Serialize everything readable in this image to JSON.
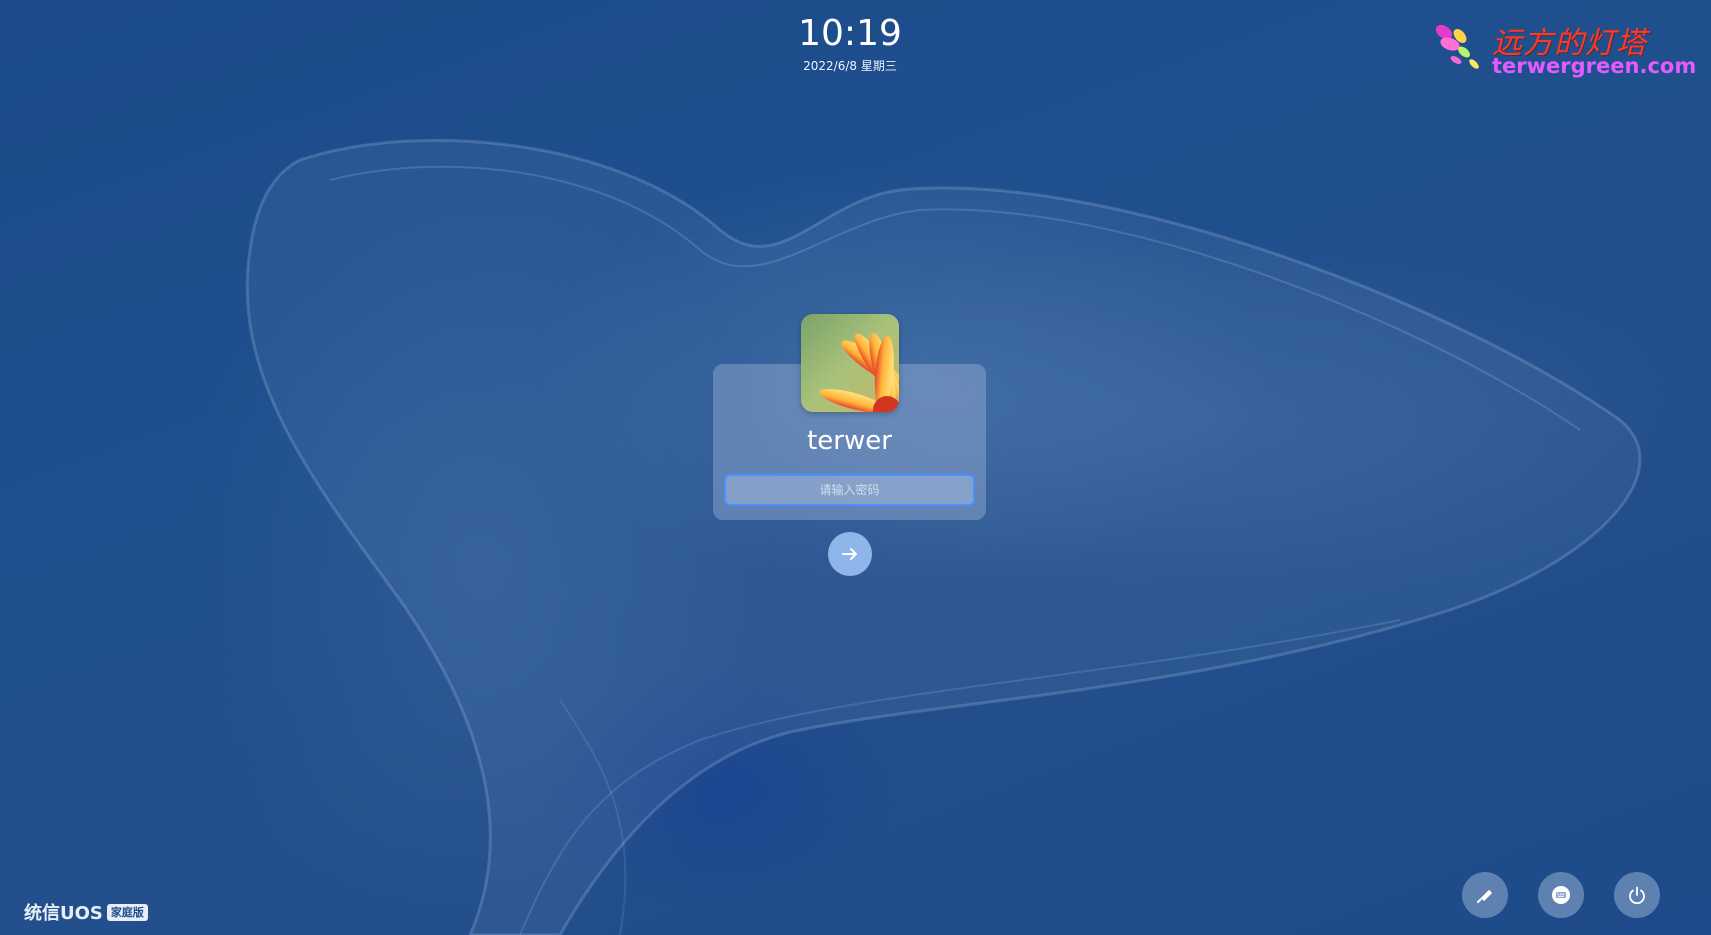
{
  "clock": {
    "time": "10:19",
    "date": "2022/6/8 星期三"
  },
  "watermark": {
    "title_cn": "远方的灯塔",
    "site": "terwergreen.com"
  },
  "login": {
    "username": "terwer",
    "password_placeholder": "请输入密码",
    "submit_icon": "arrow-right-icon"
  },
  "brand": {
    "name": "统信UOS",
    "edition": "家庭版"
  },
  "actions": [
    {
      "name": "keyboard-layout",
      "icon": "pen-icon"
    },
    {
      "name": "keyboard",
      "icon": "keyboard-icon"
    },
    {
      "name": "power",
      "icon": "power-icon"
    }
  ],
  "colors": {
    "background": "#1f4f8e",
    "accent": "#4c8fff",
    "watermark_cn": "#ff3a1f",
    "watermark_en": "#e35bff"
  }
}
